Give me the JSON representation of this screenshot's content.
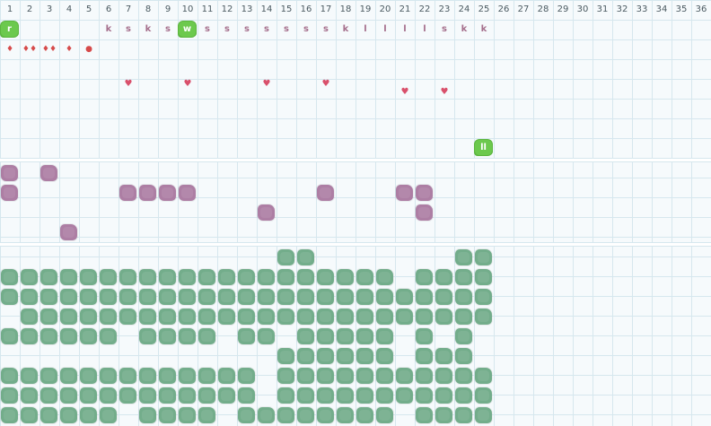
{
  "colors": {
    "grid_line": "#d6e7ee",
    "chip_green": "#6cc94d",
    "letter": "#a56f8c",
    "drop": "#d64a4a",
    "heart": "#d9506b",
    "purple_cell": "#ad7ea4",
    "green_cell": "#73ad8b"
  },
  "columns": [
    "1",
    "2",
    "3",
    "4",
    "5",
    "6",
    "7",
    "8",
    "9",
    "10",
    "11",
    "12",
    "13",
    "14",
    "15",
    "16",
    "17",
    "18",
    "19",
    "20",
    "21",
    "22",
    "23",
    "24",
    "25",
    "26",
    "27",
    "28",
    "29",
    "30",
    "31",
    "32",
    "33",
    "34",
    "35",
    "36"
  ],
  "top_band": {
    "chips": [
      {
        "col": 1,
        "row": 1,
        "text": "r"
      },
      {
        "col": 10,
        "row": 1,
        "text": "w"
      },
      {
        "col": 25,
        "row": 7,
        "text": "ll"
      }
    ],
    "letters": [
      {
        "col": 6,
        "text": "k"
      },
      {
        "col": 7,
        "text": "s"
      },
      {
        "col": 8,
        "text": "k"
      },
      {
        "col": 9,
        "text": "s"
      },
      {
        "col": 11,
        "text": "s"
      },
      {
        "col": 12,
        "text": "s"
      },
      {
        "col": 13,
        "text": "s"
      },
      {
        "col": 14,
        "text": "s"
      },
      {
        "col": 15,
        "text": "s"
      },
      {
        "col": 16,
        "text": "s"
      },
      {
        "col": 17,
        "text": "s"
      },
      {
        "col": 18,
        "text": "k"
      },
      {
        "col": 19,
        "text": "l"
      },
      {
        "col": 20,
        "text": "l"
      },
      {
        "col": 21,
        "text": "l"
      },
      {
        "col": 22,
        "text": "l"
      },
      {
        "col": 23,
        "text": "s"
      },
      {
        "col": 24,
        "text": "k"
      },
      {
        "col": 25,
        "text": "k"
      }
    ],
    "drops": [
      {
        "col": 1,
        "glyph": "♦"
      },
      {
        "col": 2,
        "glyph": "♦♦"
      },
      {
        "col": 3,
        "glyph": "♦♦"
      },
      {
        "col": 4,
        "glyph": "♦"
      },
      {
        "col": 5,
        "glyph": "●"
      }
    ],
    "hearts": [
      {
        "col": 7,
        "row": 4
      },
      {
        "col": 10,
        "row": 4
      },
      {
        "col": 14,
        "row": 4
      },
      {
        "col": 17,
        "row": 4
      },
      {
        "col": 21,
        "row": 4
      },
      {
        "col": 23,
        "row": 4
      }
    ]
  },
  "middle_band": {
    "cells": [
      {
        "row": 0,
        "cols": [
          1,
          3
        ]
      },
      {
        "row": 1,
        "cols": [
          1,
          7,
          8,
          9,
          10,
          17,
          21,
          22
        ]
      },
      {
        "row": 2,
        "cols": [
          14,
          22
        ]
      },
      {
        "row": 3,
        "cols": [
          4
        ]
      }
    ]
  },
  "bottom_band": {
    "cells": [
      {
        "row": 0,
        "cols": [
          15,
          16,
          24,
          25
        ]
      },
      {
        "row": 1,
        "cols": [
          1,
          2,
          3,
          4,
          5,
          6,
          7,
          8,
          9,
          10,
          11,
          12,
          13,
          14,
          15,
          16,
          17,
          18,
          19,
          20,
          22,
          23,
          24,
          25
        ]
      },
      {
        "row": 2,
        "cols": [
          1,
          2,
          3,
          4,
          5,
          6,
          7,
          8,
          9,
          10,
          11,
          12,
          13,
          14,
          15,
          16,
          17,
          18,
          19,
          20,
          21,
          22,
          23,
          24,
          25
        ]
      },
      {
        "row": 3,
        "cols": [
          2,
          3,
          4,
          5,
          6,
          7,
          8,
          9,
          10,
          11,
          12,
          13,
          14,
          15,
          16,
          17,
          18,
          19,
          20,
          21,
          22,
          23,
          24,
          25
        ]
      },
      {
        "row": 4,
        "cols": [
          1,
          2,
          3,
          4,
          5,
          6,
          8,
          9,
          10,
          11,
          13,
          14,
          16,
          17,
          18,
          19,
          20,
          22,
          24
        ]
      },
      {
        "row": 5,
        "cols": [
          15,
          16,
          17,
          18,
          19,
          20,
          22,
          23,
          24
        ]
      },
      {
        "row": 6,
        "cols": [
          1,
          2,
          3,
          4,
          5,
          6,
          7,
          8,
          9,
          10,
          11,
          12,
          13,
          15,
          16,
          17,
          18,
          19,
          20,
          21,
          22,
          23,
          24,
          25
        ]
      },
      {
        "row": 7,
        "cols": [
          1,
          2,
          3,
          4,
          5,
          6,
          7,
          8,
          9,
          10,
          11,
          12,
          13,
          15,
          16,
          17,
          18,
          19,
          20,
          21,
          22,
          23,
          24,
          25
        ]
      },
      {
        "row": 8,
        "cols": [
          1,
          2,
          3,
          4,
          5,
          6,
          8,
          9,
          10,
          11,
          13,
          14,
          15,
          16,
          17,
          18,
          19,
          20,
          22,
          23,
          24,
          25
        ]
      }
    ]
  }
}
